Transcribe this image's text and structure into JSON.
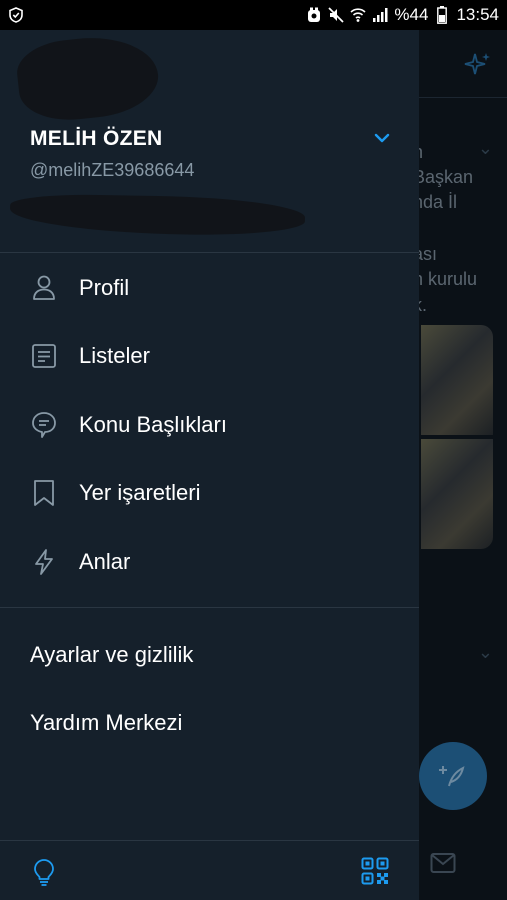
{
  "status_bar": {
    "battery_percent": "%44",
    "time": "13:54"
  },
  "drawer": {
    "account": {
      "name": "MELİH ÖZEN",
      "handle": "@melihZE39686644"
    },
    "menu": [
      {
        "label": "Profil",
        "icon": "person-icon"
      },
      {
        "label": "Listeler",
        "icon": "list-icon"
      },
      {
        "label": "Konu Başlıkları",
        "icon": "topics-icon"
      },
      {
        "label": "Yer işaretleri",
        "icon": "bookmark-icon"
      },
      {
        "label": "Anlar",
        "icon": "lightning-icon"
      }
    ],
    "secondary": {
      "settings_label": "Ayarlar ve gizlilik",
      "help_label": "Yardım Merkezi"
    }
  },
  "background_feed": {
    "text_lines": [
      "n",
      "Başkan",
      "nda İl",
      "ası",
      "n kurulu",
      "k."
    ]
  },
  "colors": {
    "accent": "#1d9bf0",
    "drawer_bg": "#15202b",
    "muted_text": "#8899a6"
  }
}
